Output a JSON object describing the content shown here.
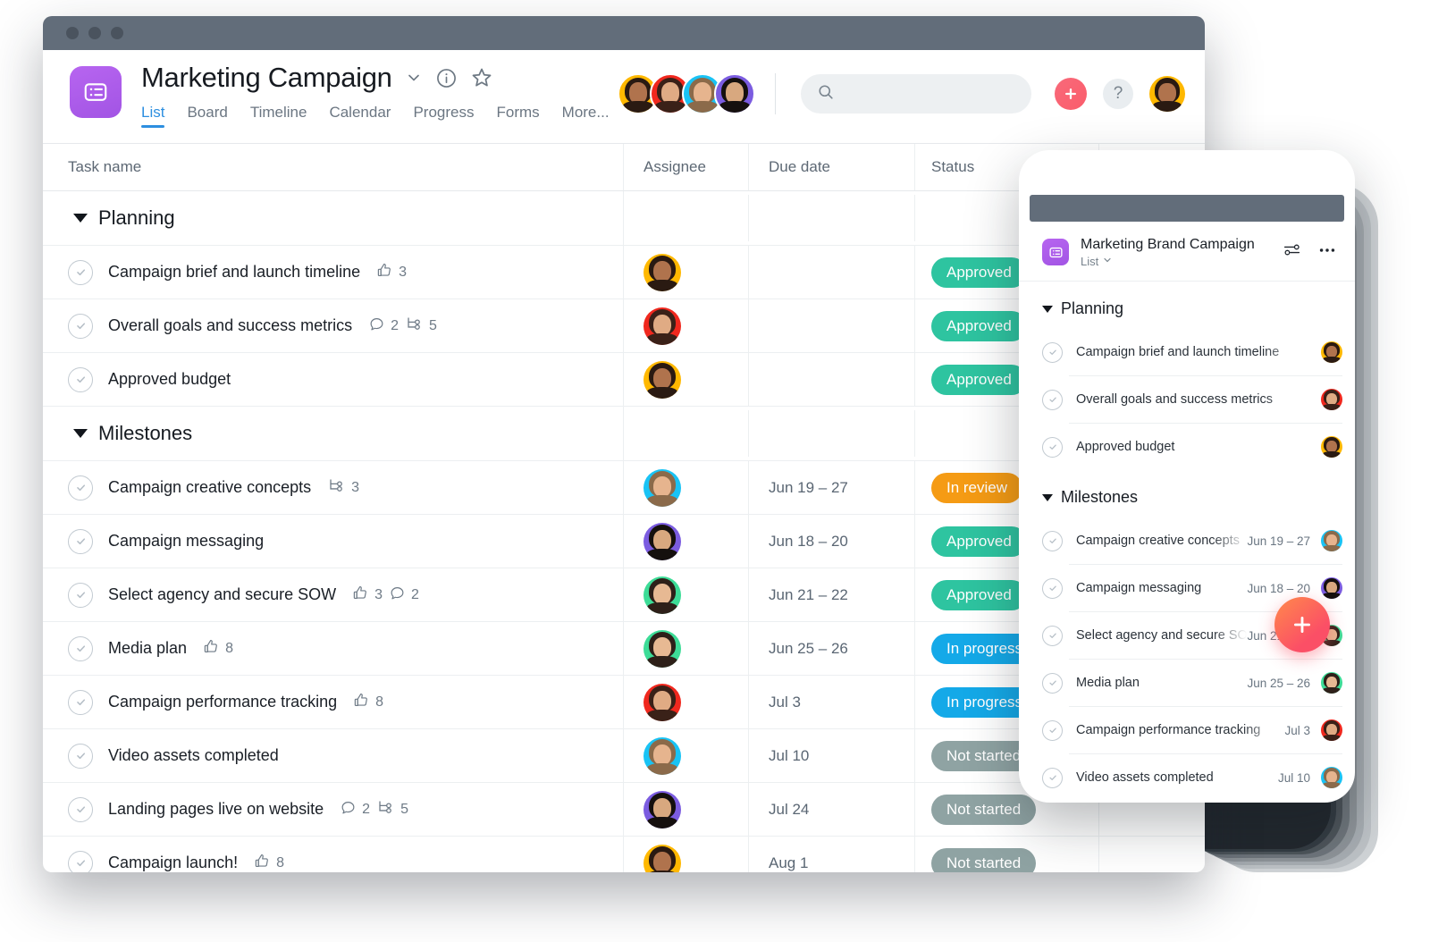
{
  "window": {
    "titlebar_dots": 3
  },
  "header": {
    "project_icon": "list-project-icon",
    "title": "Marketing Campaign",
    "chevron_icon": "chevron-down-icon",
    "info_icon": "info-circle-icon",
    "star_icon": "star-icon",
    "tabs": [
      {
        "label": "List",
        "active": true
      },
      {
        "label": "Board",
        "active": false
      },
      {
        "label": "Timeline",
        "active": false
      },
      {
        "label": "Calendar",
        "active": false
      },
      {
        "label": "Progress",
        "active": false
      },
      {
        "label": "Forms",
        "active": false
      },
      {
        "label": "More...",
        "active": false
      }
    ],
    "facepile": [
      {
        "name": "member-1",
        "color": "#FFB800",
        "hair": "#2a1a12",
        "skin": "#b0734d"
      },
      {
        "name": "member-2",
        "color": "#F0281E",
        "hair": "#3a2118",
        "skin": "#e0ab84"
      },
      {
        "name": "member-3",
        "color": "#19C3F5",
        "hair": "#8b6a4a",
        "skin": "#e6b48e"
      },
      {
        "name": "member-4",
        "color": "#7B5CE0",
        "hair": "#15100e",
        "skin": "#d8a87f"
      }
    ],
    "search": {
      "value": "",
      "placeholder": "",
      "icon": "search-icon"
    },
    "add_button": {
      "label": "+",
      "color": "#FB5C6B"
    },
    "help_button": {
      "label": "?"
    },
    "user_avatar": {
      "name": "current-user-avatar",
      "color": "#FFB800",
      "hair": "#2a1a12",
      "skin": "#b0734d"
    }
  },
  "table": {
    "columns": [
      "Task name",
      "Assignee",
      "Due date",
      "Status"
    ],
    "sections": [
      {
        "title": "Planning",
        "rows": [
          {
            "name": "Campaign brief and launch timeline",
            "meta": [
              {
                "icon": "thumbs-up-icon",
                "count": "3"
              }
            ],
            "assignee": {
              "color": "#FFB800",
              "hair": "#2a1a12",
              "skin": "#b0734d"
            },
            "date": "",
            "status": {
              "label": "Approved",
              "color": "#2EC4A0"
            }
          },
          {
            "name": "Overall goals and success metrics",
            "meta": [
              {
                "icon": "comment-icon",
                "count": "2"
              },
              {
                "icon": "subtask-icon",
                "count": "5"
              }
            ],
            "assignee": {
              "color": "#F0281E",
              "hair": "#3a2118",
              "skin": "#e0ab84"
            },
            "date": "",
            "status": {
              "label": "Approved",
              "color": "#2EC4A0"
            }
          },
          {
            "name": "Approved budget",
            "meta": [],
            "assignee": {
              "color": "#FFB800",
              "hair": "#2a1a12",
              "skin": "#b0734d"
            },
            "date": "",
            "status": {
              "label": "Approved",
              "color": "#2EC4A0"
            }
          }
        ]
      },
      {
        "title": "Milestones",
        "rows": [
          {
            "name": "Campaign creative concepts",
            "meta": [
              {
                "icon": "subtask-icon",
                "count": "3"
              }
            ],
            "assignee": {
              "color": "#19C3F5",
              "hair": "#8b6a4a",
              "skin": "#e6b48e"
            },
            "date": "Jun 19 – 27",
            "status": {
              "label": "In review",
              "color": "#F59B14"
            }
          },
          {
            "name": "Campaign messaging",
            "meta": [],
            "assignee": {
              "color": "#7B5CE0",
              "hair": "#15100e",
              "skin": "#d8a87f"
            },
            "date": "Jun 18 – 20",
            "status": {
              "label": "Approved",
              "color": "#2EC4A0"
            }
          },
          {
            "name": "Select agency and secure SOW",
            "meta": [
              {
                "icon": "thumbs-up-icon",
                "count": "3"
              },
              {
                "icon": "comment-icon",
                "count": "2"
              }
            ],
            "assignee": {
              "color": "#3DDC97",
              "hair": "#2e2019",
              "skin": "#e7b993"
            },
            "date": "Jun 21 – 22",
            "status": {
              "label": "Approved",
              "color": "#2EC4A0"
            }
          },
          {
            "name": "Media plan",
            "meta": [
              {
                "icon": "thumbs-up-icon",
                "count": "8"
              }
            ],
            "assignee": {
              "color": "#3DDC97",
              "hair": "#2e2019",
              "skin": "#e7b993"
            },
            "date": "Jun 25 – 26",
            "status": {
              "label": "In progress",
              "color": "#14A9E8"
            }
          },
          {
            "name": "Campaign performance tracking",
            "meta": [
              {
                "icon": "thumbs-up-icon",
                "count": "8"
              }
            ],
            "assignee": {
              "color": "#F0281E",
              "hair": "#3a2118",
              "skin": "#e0ab84"
            },
            "date": "Jul 3",
            "status": {
              "label": "In progress",
              "color": "#14A9E8"
            }
          },
          {
            "name": "Video assets completed",
            "meta": [],
            "assignee": {
              "color": "#19C3F5",
              "hair": "#8b6a4a",
              "skin": "#e6b48e"
            },
            "date": "Jul 10",
            "status": {
              "label": "Not started",
              "color": "#8FA3A3"
            }
          },
          {
            "name": "Landing pages live on website",
            "meta": [
              {
                "icon": "comment-icon",
                "count": "2"
              },
              {
                "icon": "subtask-icon",
                "count": "5"
              }
            ],
            "assignee": {
              "color": "#7B5CE0",
              "hair": "#15100e",
              "skin": "#d8a87f"
            },
            "date": "Jul 24",
            "status": {
              "label": "Not started",
              "color": "#8FA3A3"
            }
          },
          {
            "name": "Campaign launch!",
            "meta": [
              {
                "icon": "thumbs-up-icon",
                "count": "8"
              }
            ],
            "assignee": {
              "color": "#FFB800",
              "hair": "#2a1a12",
              "skin": "#b0734d"
            },
            "date": "Aug 1",
            "status": {
              "label": "Not started",
              "color": "#8FA3A3"
            }
          }
        ]
      }
    ]
  },
  "phone": {
    "project_icon": "list-project-icon",
    "title": "Marketing Brand Campaign",
    "view_label": "List",
    "view_chevron_icon": "chevron-down-icon",
    "filter_icon": "filter-sliders-icon",
    "more_icon": "more-horizontal-icon",
    "fab": {
      "label": "+",
      "icon": "plus-icon"
    },
    "sections": [
      {
        "title": "Planning",
        "rows": [
          {
            "name": "Campaign brief and launch timeline",
            "date": "",
            "assignee": {
              "color": "#FFB800",
              "hair": "#2a1a12",
              "skin": "#b0734d"
            }
          },
          {
            "name": "Overall goals and success metrics",
            "date": "",
            "assignee": {
              "color": "#F0281E",
              "hair": "#3a2118",
              "skin": "#e0ab84"
            }
          },
          {
            "name": "Approved budget",
            "date": "",
            "assignee": {
              "color": "#FFB800",
              "hair": "#2a1a12",
              "skin": "#b0734d"
            }
          }
        ]
      },
      {
        "title": "Milestones",
        "rows": [
          {
            "name": "Campaign creative concepts",
            "date": "Jun 19 – 27",
            "assignee": {
              "color": "#19C3F5",
              "hair": "#8b6a4a",
              "skin": "#e6b48e"
            }
          },
          {
            "name": "Campaign messaging",
            "date": "Jun 18 – 20",
            "assignee": {
              "color": "#7B5CE0",
              "hair": "#15100e",
              "skin": "#d8a87f"
            }
          },
          {
            "name": "Select agency and secure SOW",
            "date": "Jun 21 – 22",
            "assignee": {
              "color": "#3DDC97",
              "hair": "#2e2019",
              "skin": "#e7b993"
            }
          },
          {
            "name": "Media plan",
            "date": "Jun 25 – 26",
            "assignee": {
              "color": "#3DDC97",
              "hair": "#2e2019",
              "skin": "#e7b993"
            }
          },
          {
            "name": "Campaign performance tracking",
            "date": "Jul 3",
            "assignee": {
              "color": "#F0281E",
              "hair": "#3a2118",
              "skin": "#e0ab84"
            }
          },
          {
            "name": "Video assets completed",
            "date": "Jul 10",
            "assignee": {
              "color": "#19C3F5",
              "hair": "#8b6a4a",
              "skin": "#e6b48e"
            }
          }
        ]
      }
    ]
  },
  "colors": {
    "accent_blue": "#2d8fe0",
    "brand_purple": "#a254e4",
    "status_approved": "#2EC4A0",
    "status_in_review": "#F59B14",
    "status_in_progress": "#14A9E8",
    "status_not_started": "#8FA3A3",
    "titlebar": "#626d7a"
  }
}
